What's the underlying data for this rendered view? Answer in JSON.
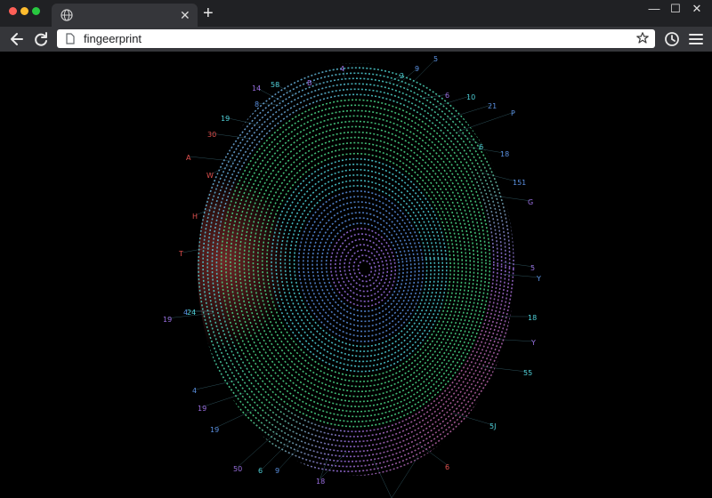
{
  "browser": {
    "tab": {
      "icon": "globe-icon",
      "close_icon": "close-icon"
    },
    "new_tab_icon": "plus-icon",
    "window_controls": {
      "minimize": "—",
      "maximize": "☐",
      "close": "✕"
    },
    "toolbar": {
      "back_icon": "back-arrow-icon",
      "reload_icon": "reload-icon",
      "history_icon": "history-clock-icon",
      "menu_icon": "hamburger-menu-icon"
    },
    "address_bar": {
      "value": "fingeerprint",
      "page_icon": "page-icon",
      "bookmark_icon": "star-icon"
    }
  },
  "fingerprint_labels": {
    "items": [
      {
        "text": "5"
      },
      {
        "text": "4"
      },
      {
        "text": "2"
      },
      {
        "text": "9"
      },
      {
        "text": "14"
      },
      {
        "text": "58"
      },
      {
        "text": "8"
      },
      {
        "text": "6"
      },
      {
        "text": "10"
      },
      {
        "text": "21"
      },
      {
        "text": "B"
      },
      {
        "text": "19"
      },
      {
        "text": "P"
      },
      {
        "text": "30"
      },
      {
        "text": "6"
      },
      {
        "text": "18"
      },
      {
        "text": "A"
      },
      {
        "text": "W"
      },
      {
        "text": "151"
      },
      {
        "text": "G"
      },
      {
        "text": "H"
      },
      {
        "text": "T"
      },
      {
        "text": "5"
      },
      {
        "text": "24"
      },
      {
        "text": "Y"
      },
      {
        "text": "19"
      },
      {
        "text": "18"
      },
      {
        "text": "4"
      },
      {
        "text": "Y"
      },
      {
        "text": "55"
      },
      {
        "text": "4"
      },
      {
        "text": "19"
      },
      {
        "text": "5J"
      },
      {
        "text": "19"
      },
      {
        "text": "50"
      },
      {
        "text": "6"
      },
      {
        "text": "9"
      },
      {
        "text": "18"
      },
      {
        "text": "6"
      }
    ]
  },
  "colors": {
    "chrome_dark": "#202124",
    "chrome_toolbar": "#35363a",
    "ridge_red": "#e0504e",
    "ridge_blue": "#5a8fe0",
    "ridge_cyan": "#4fd0d8",
    "ridge_green": "#4cd98a",
    "ridge_purple": "#9a6ee0"
  }
}
